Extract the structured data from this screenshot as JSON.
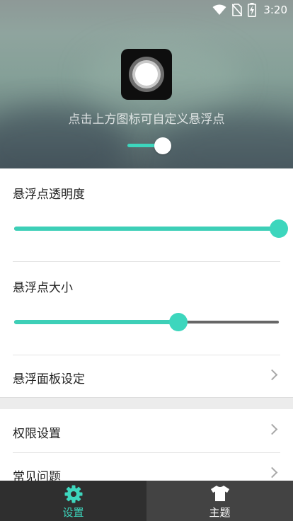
{
  "status_bar": {
    "time": "3:20",
    "icons": [
      "wifi-icon",
      "no-sim-icon",
      "battery-charging-icon"
    ]
  },
  "header": {
    "hint": "点击上方图标可自定义悬浮点",
    "toggle_on": true
  },
  "settings": {
    "opacity": {
      "label": "悬浮点透明度",
      "value": 1.0
    },
    "size": {
      "label": "悬浮点大小",
      "value": 0.62
    },
    "panel_settings": {
      "label": "悬浮面板设定"
    },
    "permissions": {
      "label": "权限设置"
    },
    "faq": {
      "label": "常见问题"
    }
  },
  "bottom_nav": {
    "tabs": [
      {
        "label": "设置",
        "icon": "gear-icon",
        "active": true
      },
      {
        "label": "主题",
        "icon": "tshirt-icon",
        "active": false
      }
    ]
  },
  "colors": {
    "accent": "#3dd6bd",
    "nav_active_bg": "#2f2f2f",
    "nav_inactive_bg": "#434343"
  }
}
